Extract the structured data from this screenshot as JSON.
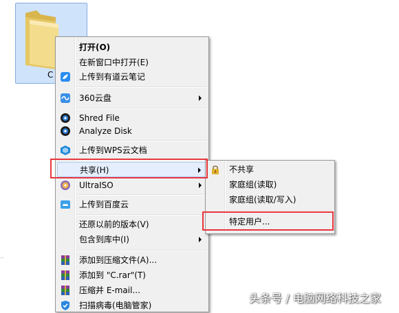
{
  "folder": {
    "label": "C"
  },
  "context_menu": {
    "open": "打开(O)",
    "open_new_window": "在新窗口中打开(E)",
    "upload_youdao": "上传到有道云笔记",
    "yunpan_360": "360云盘",
    "shred_file": "Shred File",
    "analyze_disk": "Analyze Disk",
    "upload_wps": "上传到WPS云文档",
    "share": "共享(H)",
    "ultraiso": "UltraISO",
    "upload_baidu": "上传到百度云",
    "restore_previous": "还原以前的版本(V)",
    "include_in_library": "包含到库中(I)",
    "add_to_archive": "添加到压缩文件(A)...",
    "add_to_c_rar": "添加到 \"C.rar\"(T)",
    "compress_email": "压缩并 E-mail...",
    "scan_virus": "扫描病毒(电脑管家)"
  },
  "share_submenu": {
    "no_share": "不共享",
    "homegroup_read": "家庭组(读取)",
    "homegroup_readwrite": "家庭组(读取/写入)",
    "specific_users": "特定用户..."
  },
  "watermark": "头条号 / 电脑网络科技之家",
  "colors": {
    "highlight_box": "#e8343b",
    "menu_bg": "#f0f0f0",
    "selection": "#cfe3fb"
  }
}
